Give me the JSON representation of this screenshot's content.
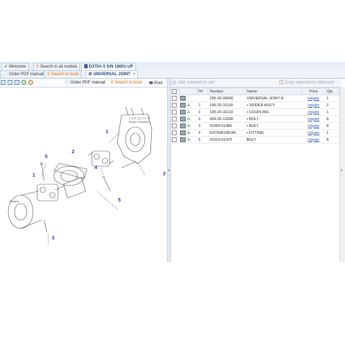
{
  "tabs": [
    {
      "icon": "check-icon",
      "label": "Welcome"
    },
    {
      "icon": "search-icon",
      "label": "Search in all models"
    },
    {
      "icon": "book-icon",
      "label": "D375A-5 S/N 18001-UP"
    }
  ],
  "subtabs": {
    "order_pdf": "Order PDF manual",
    "search_book": "Search in book",
    "current": "UNIVERSAL JOINT",
    "close": "×"
  },
  "left_toolbar": {
    "order_pdf": "Order PDF manual",
    "search_book": "Search in book",
    "print": "Print"
  },
  "right_toolbar": {
    "add_cart": "Add selected to cart",
    "copy_clipboard": "Copy selected to clipboard"
  },
  "columns": [
    "Nº",
    "Number",
    "Name",
    "Price",
    "Qty"
  ],
  "rows": [
    {
      "no": "",
      "number": "195-20-00040",
      "name": "UNIVERSAL JOINT A.",
      "price": "Inquire",
      "qty": "1",
      "tree": false
    },
    {
      "no": "1",
      "number": "195-20-31100",
      "name": "• SPIDER ASS'Y",
      "price": "Inquire",
      "qty": "2",
      "tree": true
    },
    {
      "no": "2",
      "number": "195-20-32110",
      "name": "• COUPLING",
      "price": "Inquire",
      "qty": "1",
      "tree": true
    },
    {
      "no": "3",
      "number": "426-20-12690",
      "name": "• BOLT",
      "price": "Inquire",
      "qty": "8",
      "tree": true
    },
    {
      "no": "3",
      "number": "01050-51480",
      "name": "• BOLT",
      "price": "Inquire",
      "qty": "8",
      "tree": true
    },
    {
      "no": "4",
      "number": "KSYWA108140",
      "name": "• FITTING",
      "price": "Inquire",
      "qty": "1",
      "tree": true
    },
    {
      "no": "5",
      "number": "01010-61470",
      "name": "BOLT",
      "price": "Inquire",
      "qty": "8",
      "tree": true
    }
  ],
  "diagram": {
    "callouts": [
      "1",
      "2",
      "3",
      "4",
      "5",
      "1",
      "5",
      "3",
      "5",
      "3"
    ],
    "labels": [
      "Torque Converter",
      "Bumper"
    ],
    "jp_label": "トルクコンバータ"
  }
}
